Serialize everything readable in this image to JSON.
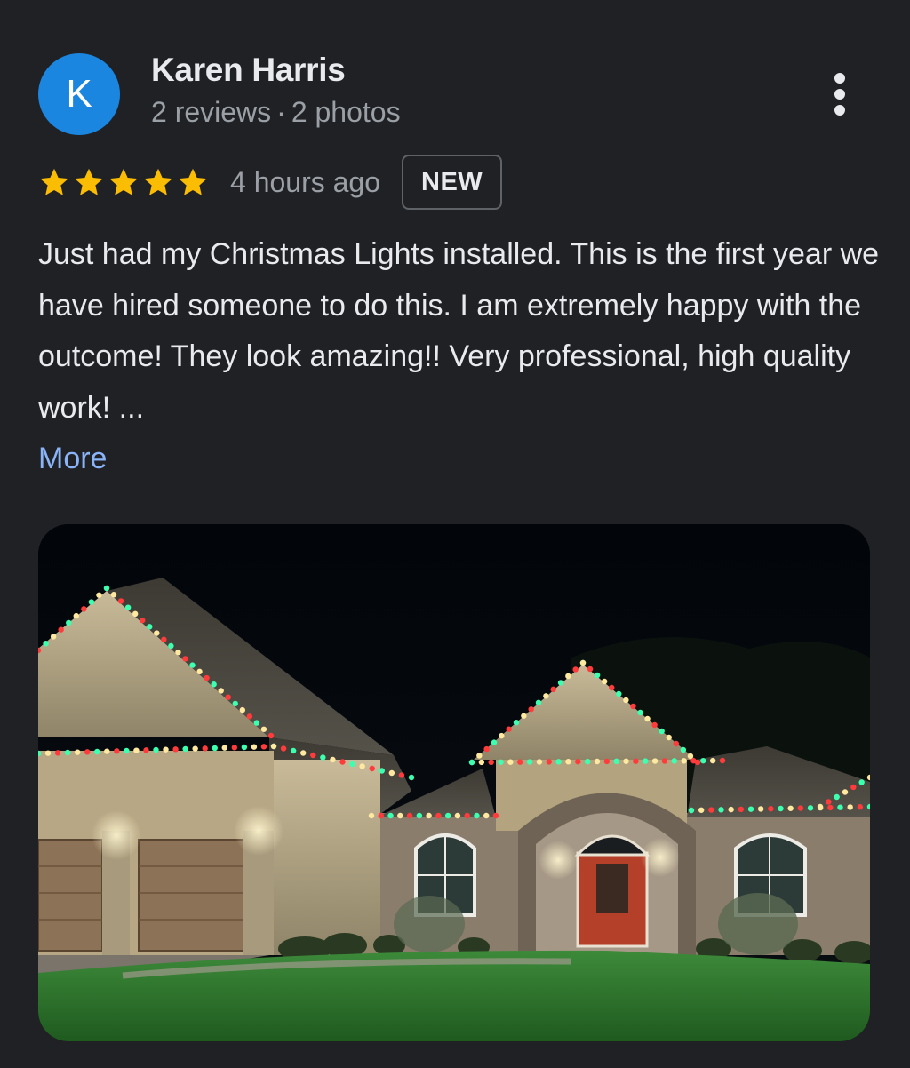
{
  "author": {
    "initial": "K",
    "name": "Karen Harris",
    "reviews": "2 reviews",
    "separator": "·",
    "photos": "2 photos"
  },
  "rating": {
    "stars": 5,
    "max_stars": 5,
    "star_color": "#fbbc04",
    "time_ago": "4 hours ago",
    "badge": "NEW"
  },
  "review": {
    "text": "Just had my Christmas Lights installed. This is the first year we have hired someone to do this. I am extremely happy with the outcome! They look amazing!! Very professional, high quality work! ...",
    "more_label": "More"
  },
  "photo": {
    "icon": "review-photo",
    "light_colors": [
      "#ff3b3b",
      "#3dffb0",
      "#ffe8a0"
    ]
  },
  "menu": {
    "icon": "more-vert-icon"
  },
  "colors": {
    "background": "#202124",
    "avatar": "#1a86e0",
    "link": "#8ab4f8",
    "secondary_text": "#9aa0a6"
  }
}
